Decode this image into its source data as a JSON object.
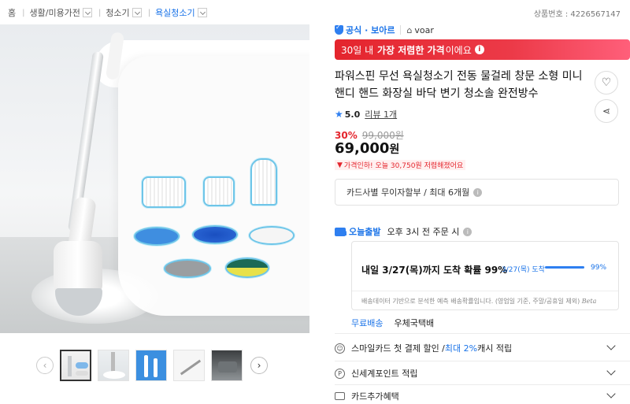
{
  "breadcrumb": {
    "home": "홈",
    "items": [
      "생활/미용가전",
      "청소기",
      "욕실청소기"
    ]
  },
  "product_number": "상품번호 : 4226567147",
  "badge": {
    "official_label": "공식 · 보아르"
  },
  "store": {
    "name": "voar"
  },
  "promo": {
    "prefix": "30일 내",
    "highlight": "가장 저렴한 가격",
    "suffix": "이에요"
  },
  "product": {
    "title": "파워스핀 무선 욕실청소기 전동 물걸레 창문 소형 미니 핸디 핸드 화장실 바닥 변기 청소솔 완전방수"
  },
  "rating": {
    "score": "5.0",
    "reviews_label": "리뷰 1개"
  },
  "price": {
    "discount": "30%",
    "original": "99,000원",
    "current": "69,000",
    "currency": "원",
    "drop_note": "가격인하! 오늘 30,750원 저렴해졌어요"
  },
  "card": {
    "installment": "카드사별 무이자할부 / 최대 6개월"
  },
  "shipping": {
    "brand": "오늘출발",
    "cutoff": "오후 3시 전 주문 시",
    "estimate": "내일 3/27(목)까지 도착 확률 99%",
    "date_label": "3/27(목) 도착",
    "percent_label": "99%",
    "percent_value": 0.99,
    "note": "배송데이터 기반으로 분석한 예측 배송확률입니다. (영업일 기준, 주말/공휴일 제외)",
    "beta": "Beta",
    "options": [
      "무료배송",
      "우체국택배"
    ]
  },
  "benefits": [
    {
      "prefix": "스마일카드 첫 결제 할인 / ",
      "highlight": "최대 2%",
      "suffix": " 캐시 적립"
    },
    {
      "prefix": "신세계포인트 적립",
      "highlight": "",
      "suffix": ""
    },
    {
      "prefix": "카드추가혜택",
      "highlight": "",
      "suffix": ""
    }
  ],
  "icons": {
    "like": "heart-icon",
    "share": "share-icon",
    "prev": "chevron-left-icon",
    "next": "chevron-right-icon"
  },
  "colors": {
    "accent": "#1a73e8",
    "sale_red": "#e4252d"
  }
}
